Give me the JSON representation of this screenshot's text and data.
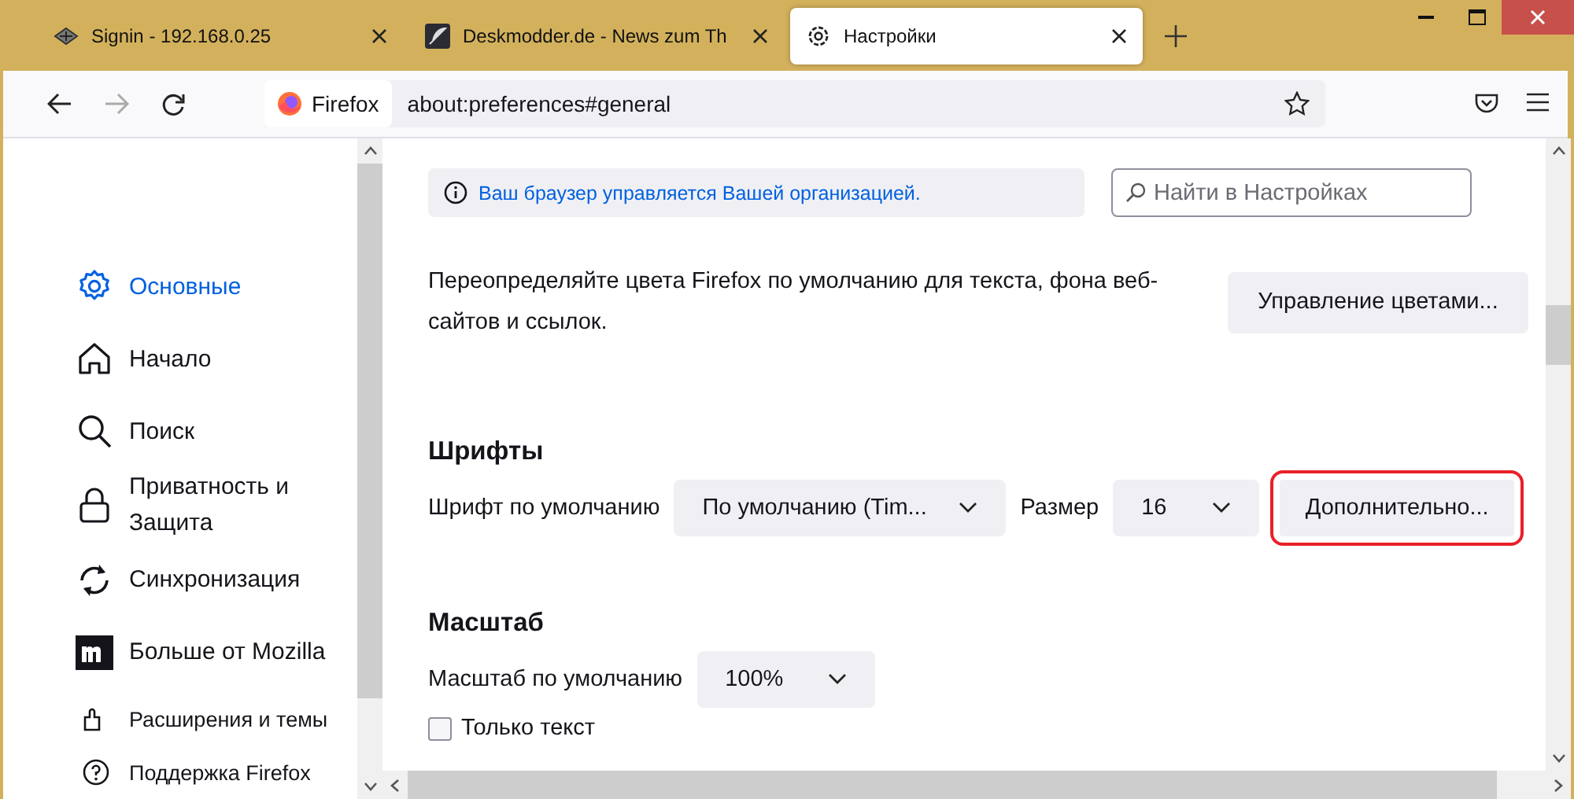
{
  "tabs": [
    {
      "title": "Signin - 192.168.0.25",
      "selected": false
    },
    {
      "title": "Deskmodder.de - News zum Th",
      "selected": false
    },
    {
      "title": "Настройки",
      "selected": true
    }
  ],
  "address_bar": {
    "identity": "Firefox",
    "url": "about:preferences#general"
  },
  "sidebar": {
    "items": [
      {
        "label": "Основные",
        "selected": true
      },
      {
        "label": "Начало",
        "selected": false
      },
      {
        "label": "Поиск",
        "selected": false
      },
      {
        "label": "Приватность и Защита",
        "selected": false
      },
      {
        "label": "Синхронизация",
        "selected": false
      },
      {
        "label": "Больше от Mozilla",
        "selected": false
      }
    ],
    "footer_links": [
      "Расширения и темы",
      "Поддержка Firefox"
    ]
  },
  "notice": "Ваш браузер управляется Вашей организацией.",
  "search": {
    "placeholder": "Найти в Настройках"
  },
  "colors": {
    "description": "Переопределяйте цвета Firefox по умолчанию для текста, фона веб-сайтов и ссылок.",
    "button": "Управление цветами..."
  },
  "fonts": {
    "heading": "Шрифты",
    "font_label": "Шрифт по умолчанию",
    "font_value": "По умолчанию (Tim...",
    "size_label": "Размер",
    "size_value": "16",
    "advanced_button": "Дополнительно...",
    "advanced_highlighted": true
  },
  "zoom": {
    "heading": "Масштаб",
    "label": "Масштаб по умолчанию",
    "value": "100%",
    "text_only": {
      "label": "Только текст",
      "checked": false
    }
  }
}
